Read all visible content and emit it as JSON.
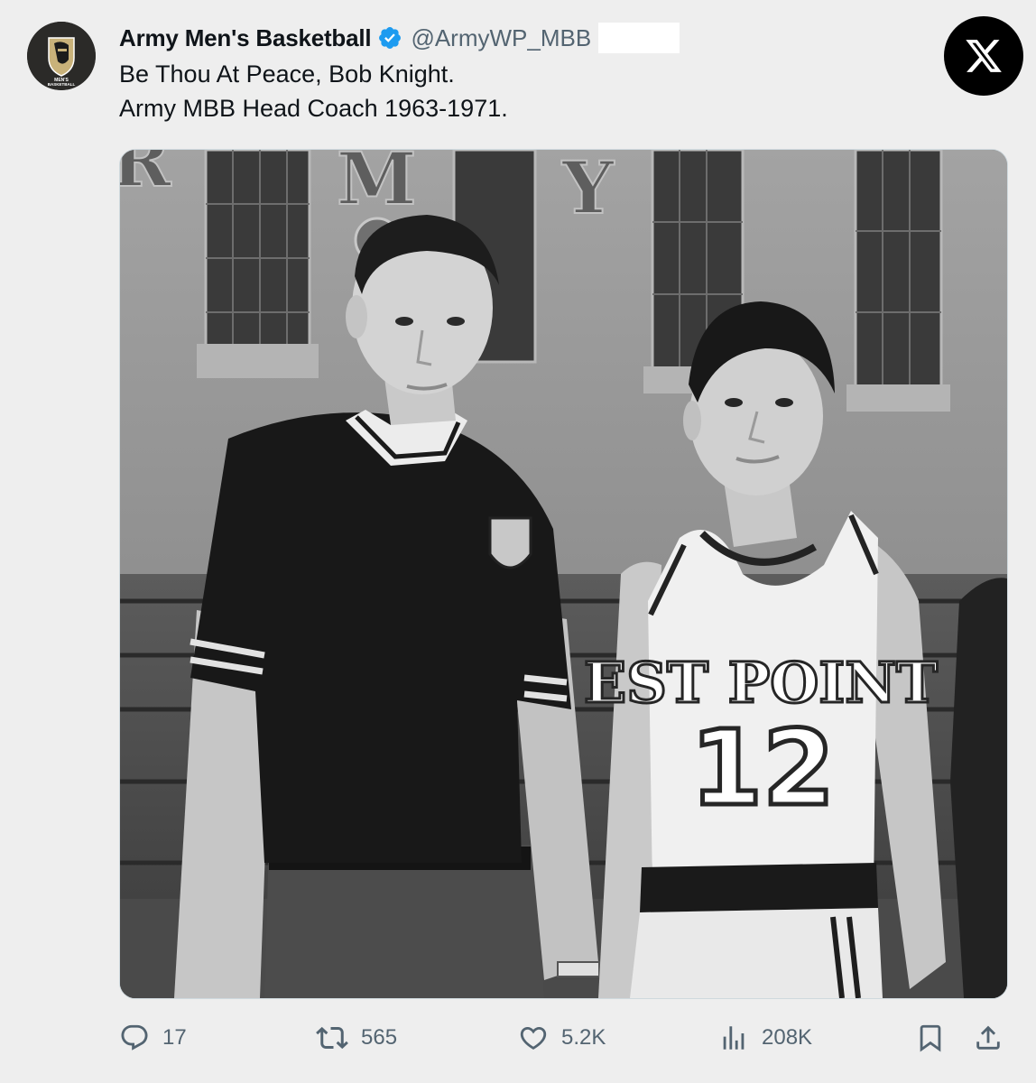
{
  "tweet": {
    "display_name": "Army Men's Basketball",
    "handle": "@ArmyWP_MBB",
    "text_lines": [
      "Be Thou At Peace, Bob Knight.",
      "Army MBB Head Coach 1963-1971."
    ],
    "avatar": {
      "icon": "army-knight-helmet-logo",
      "caption_line1": "MEN'S",
      "caption_line2": "BASKETBALL"
    },
    "photo": {
      "jersey_text": "EST POINT",
      "jersey_number": "12",
      "wall_letters": [
        "R",
        "M",
        "Y"
      ]
    }
  },
  "actions": {
    "reply": {
      "icon": "reply-icon",
      "count": "17"
    },
    "retweet": {
      "icon": "retweet-icon",
      "count": "565"
    },
    "like": {
      "icon": "heart-icon",
      "count": "5.2K"
    },
    "views": {
      "icon": "views-chart-icon",
      "count": "208K"
    },
    "bookmark": {
      "icon": "bookmark-icon"
    },
    "share": {
      "icon": "share-icon"
    }
  },
  "colors": {
    "background": "#eeeeee",
    "text": "#0f1419",
    "secondary_text": "#536471",
    "verified_blue": "#1d9bf0"
  }
}
